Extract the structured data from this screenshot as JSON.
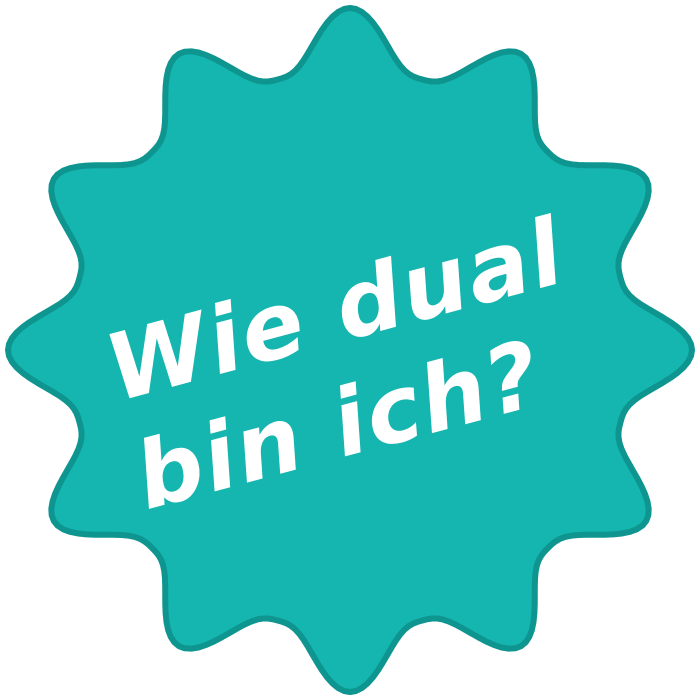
{
  "badge": {
    "line1": "Wie dual",
    "line2": "bin ich?",
    "fill_color": "#15b5b0",
    "stroke_color": "#0e9590",
    "text_color": "#ffffff"
  }
}
